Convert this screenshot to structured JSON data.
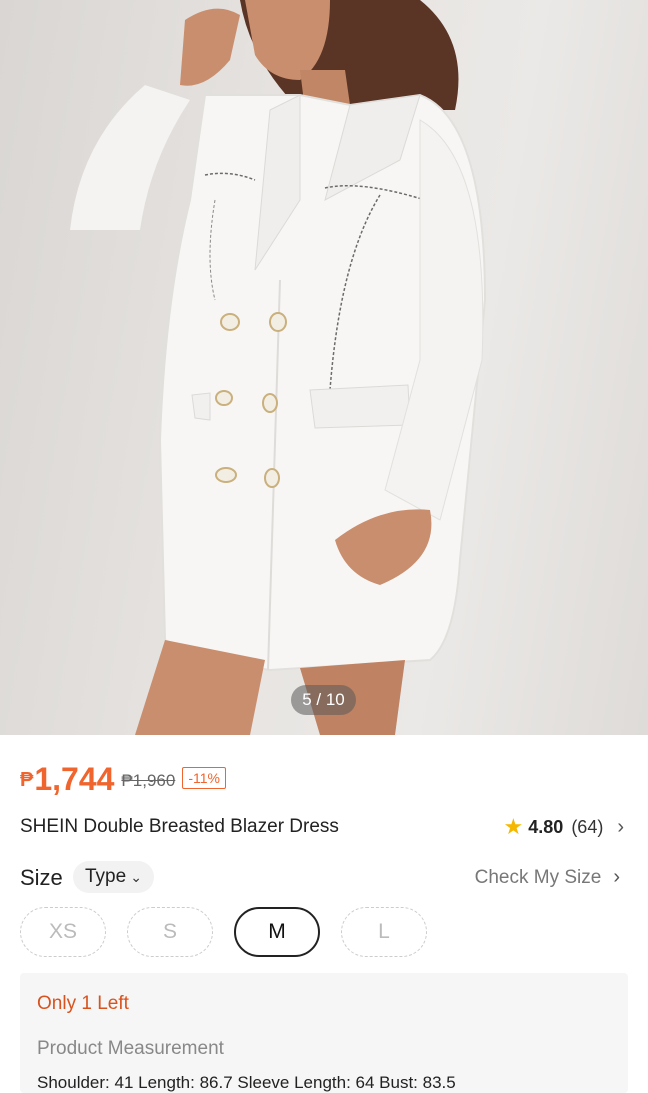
{
  "gallery": {
    "counter": "5 / 10",
    "image": "white-double-breasted-blazer-dress-photo"
  },
  "price": {
    "currency_symbol": "₱",
    "current": "1,744",
    "original": "₱1,960",
    "discount": "-11%"
  },
  "product": {
    "title": "SHEIN Double Breasted Blazer Dress",
    "rating": "4.80",
    "review_count": "(64)"
  },
  "size": {
    "label": "Size",
    "type_label": "Type",
    "check_my_size": "Check My Size",
    "options": [
      {
        "label": "XS",
        "state": "unavailable"
      },
      {
        "label": "S",
        "state": "unavailable"
      },
      {
        "label": "M",
        "state": "selected"
      },
      {
        "label": "L",
        "state": "unavailable"
      }
    ]
  },
  "stock": {
    "message": "Only 1 Left",
    "measurement_title": "Product Measurement",
    "measurement_partial": "Shoulder: 41     Length: 86.7     Sleeve Length: 64     Bust: 83.5"
  },
  "colors": {
    "accent": "#f0642d",
    "star": "#f5b800",
    "stock_text": "#d9531e"
  }
}
